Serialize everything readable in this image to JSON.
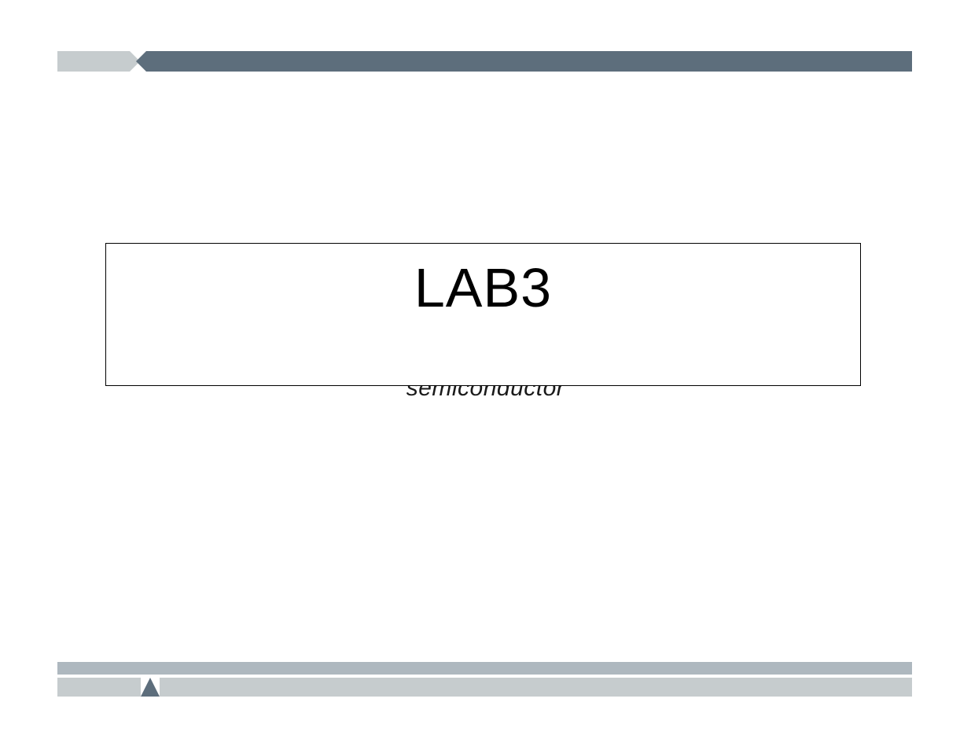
{
  "slide": {
    "title": "LAB3",
    "subtitle": "semiconductor"
  },
  "colors": {
    "accent_dark": "#5d6e7c",
    "accent_light": "#c6ccce",
    "accent_mid": "#aeb8bf"
  }
}
